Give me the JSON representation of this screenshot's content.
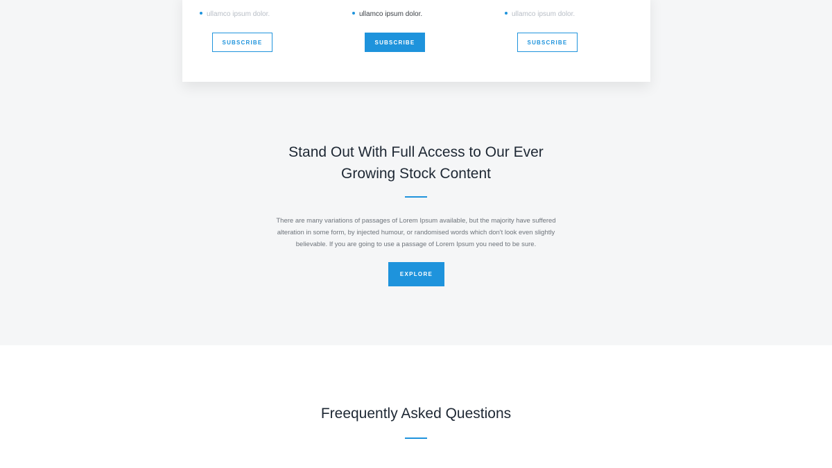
{
  "pricing": {
    "plans": [
      {
        "feature": "ullamco ipsum dolor.",
        "button": "SUBSCRIBE"
      },
      {
        "feature": "ullamco ipsum dolor.",
        "button": "SUBSCRIBE"
      },
      {
        "feature": "ullamco ipsum dolor.",
        "button": "SUBSCRIBE"
      }
    ]
  },
  "promo": {
    "title_line1": "Stand Out With Full Access to Our Ever",
    "title_line2": "Growing Stock Content",
    "body_line1": "There are many variations of passages of Lorem Ipsum available, but the majority have suffered",
    "body_line2": "alteration in some form, by injected humour, or randomised words which don't look even slightly",
    "body_line3": "believable. If you are going to use a passage of Lorem Ipsum you need to be sure.",
    "button": "EXPLORE"
  },
  "faq": {
    "title": "Freequently Asked Questions"
  },
  "colors": {
    "accent": "#1e93dc",
    "page_bg": "#f5f6f7",
    "heading": "#1d2733"
  }
}
